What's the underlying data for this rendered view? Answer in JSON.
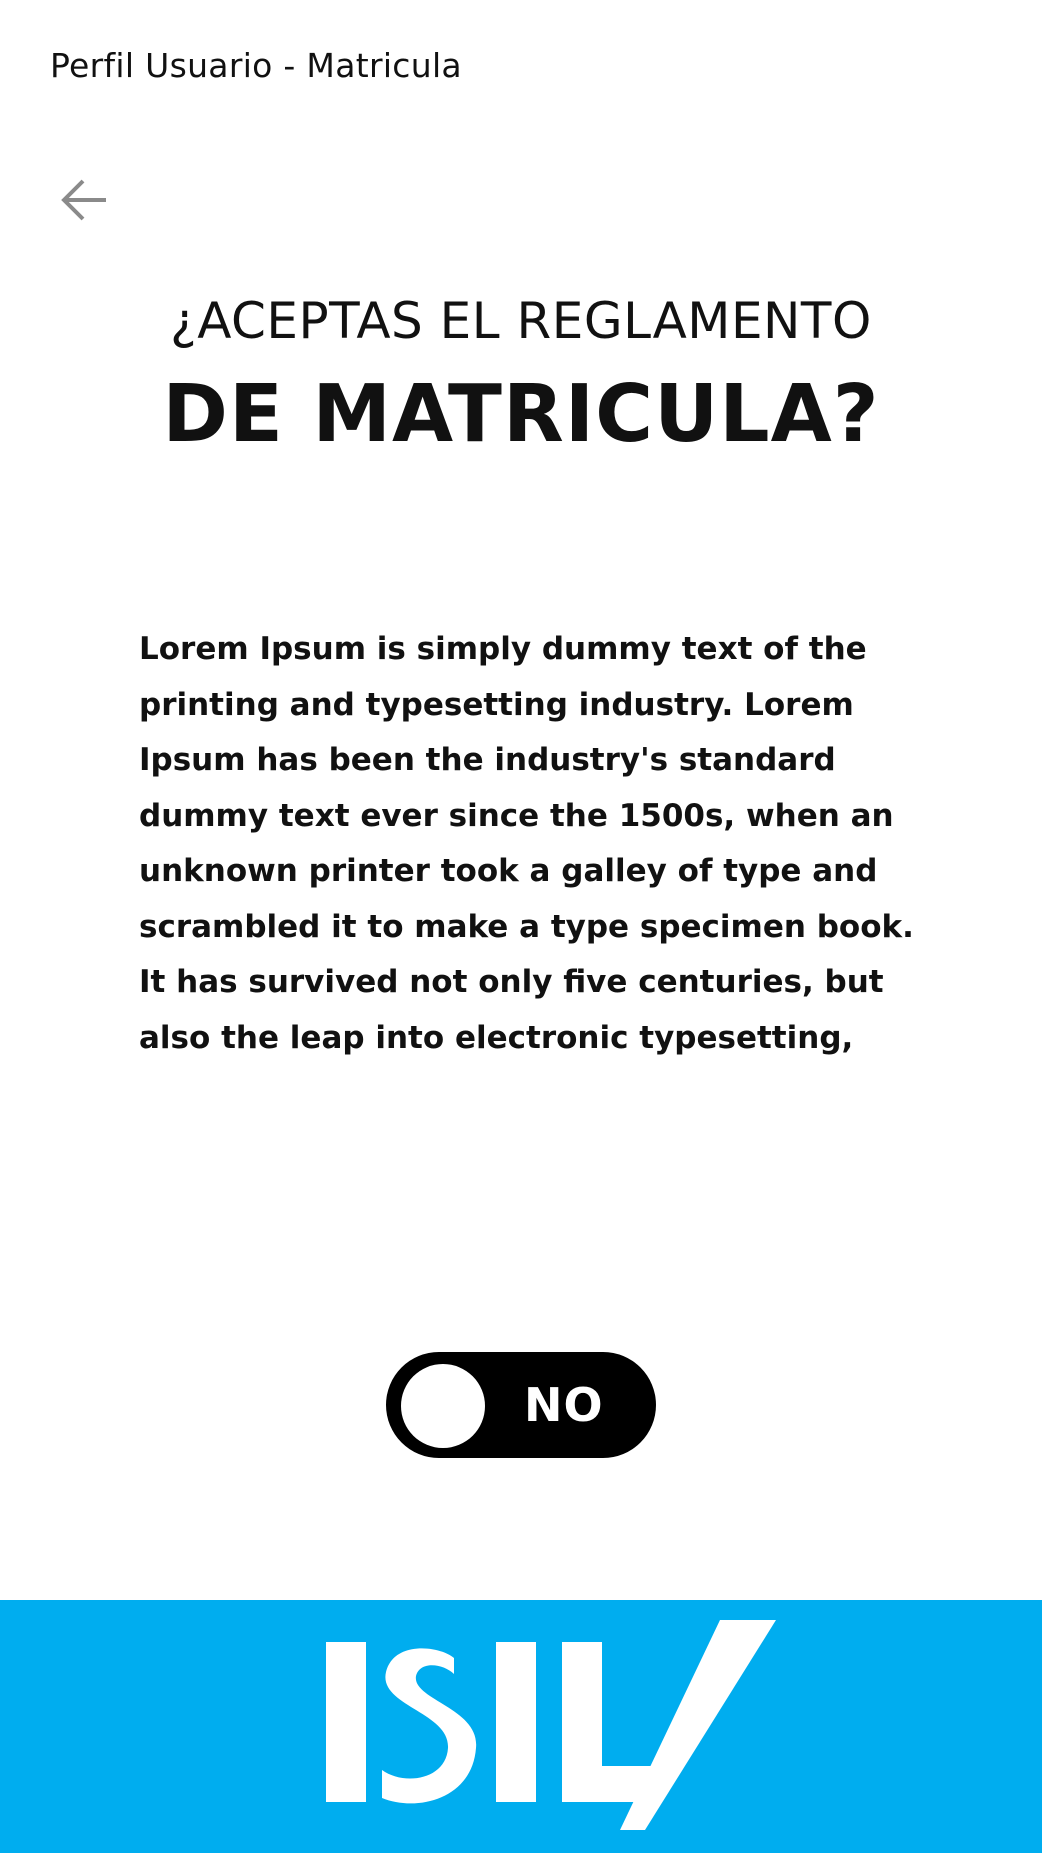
{
  "header": {
    "title": "Perfil Usuario - Matricula"
  },
  "nav": {
    "back_icon": "arrow-left-icon"
  },
  "question": {
    "line1": "¿ACEPTAS EL REGLAMENTO",
    "line2": "DE MATRICULA?"
  },
  "content": {
    "paragraph": "Lorem Ipsum is simply dummy text of the printing and typesetting industry. Lorem Ipsum has been the industry's standard dummy text ever since the 1500s, when an unknown printer took a galley of type and scrambled it to make a type specimen book. It has survived not only five centuries, but also the leap into electronic typesetting,"
  },
  "toggle": {
    "label": "NO",
    "state": "off"
  },
  "footer": {
    "logo": "ISIL",
    "background_color": "#00adef"
  },
  "colors": {
    "toggle_bg": "#000000",
    "knob": "#ffffff",
    "text": "#111111"
  }
}
